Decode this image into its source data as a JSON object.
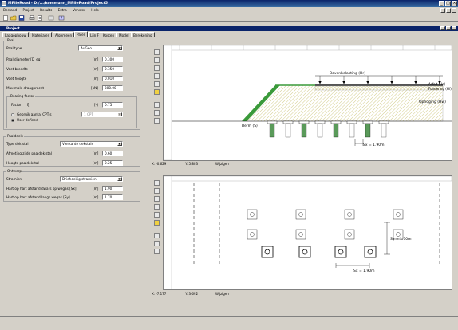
{
  "app": {
    "title": "MPileRoad - D:/.../kommunn_MPileRoad/Project5",
    "window_controls": [
      "minimize-icon",
      "maximize-icon",
      "close-icon"
    ]
  },
  "menu": [
    "Bestand",
    "Project",
    "Results",
    "Extra",
    "Venster",
    "Help"
  ],
  "toolbar_icons": [
    "new-icon",
    "open-icon",
    "save-icon",
    "print-icon",
    "preview-icon",
    "export-icon",
    "calculate-icon",
    "help-icon"
  ],
  "subwindow": {
    "title": "Project"
  },
  "tabs": [
    {
      "label": "Laagopbouw"
    },
    {
      "label": "Materialen"
    },
    {
      "label": "Algemeen"
    },
    {
      "label": "Palen"
    },
    {
      "label": "Lijn F"
    },
    {
      "label": "Kosten"
    },
    {
      "label": "Model"
    },
    {
      "label": "Berekening"
    }
  ],
  "active_tab": "Palen",
  "paal": {
    "group": "Paal",
    "paal_type_label": "Paal type",
    "paal_type_value": "AuGeo",
    "rows": [
      {
        "label": "Paal diameter [D_eq]",
        "unit": "[m]",
        "value": "0.300"
      },
      {
        "label": "Voet breedte",
        "unit": "[m]",
        "value": "0.350"
      },
      {
        "label": "Voet hoogte",
        "unit": "[m]",
        "value": "0.010"
      },
      {
        "label": "Maximale draagkracht",
        "unit": "[kN]",
        "value": "300.00"
      }
    ]
  },
  "bearing": {
    "group": "Bearing factor",
    "factor_label": "Factor",
    "factor_symbol": "ξ",
    "factor_unit": "[-]",
    "factor_value": "0.75",
    "radio1": "Gebruik aantal CPT's",
    "radio2": "User defined",
    "cpt_select": "1 CPT"
  },
  "paaldeel": {
    "group": "Paaldeels",
    "type_label": "Type dek.stal",
    "type_value": "Vierkante dekstals",
    "afmeting_label": "Afmeting zijde paaldek.stal",
    "afmeting_unit": "[m]",
    "afmeting_value": "0.60",
    "hoogte_label": "Hoogte paaldekstal",
    "hoogte_unit": "[m]",
    "hoogte_value": "0.25"
  },
  "ontwerp": {
    "group": "Ontwerp",
    "stramien_label": "Stramien",
    "stramien_value": "Driehoekig stramien",
    "rows": [
      {
        "label": "Hart op hart afstand dwars op wegas [Sx]",
        "unit": "[m]",
        "value": "1.90"
      },
      {
        "label": "Hart op hart afstand langs wegas [Sy]",
        "unit": "[m]",
        "value": "1.70"
      }
    ]
  },
  "top_view": {
    "labels": {
      "verkeer": "Bovenbelasting (Hr)",
      "asfalt": "Asfalt (Ha)",
      "fundering": "Fundering (Hf)",
      "ophoging": "Ophoging (Hw)",
      "berm": "Berm (S)",
      "sx": "Sx = 1.90m"
    },
    "status": {
      "x": "X: -0.629",
      "y": "Y: 5.803",
      "mode": "Wijzigen"
    }
  },
  "bottom_view": {
    "labels": {
      "sy": "Sy = 1.70m",
      "sx": "Sx = 1.90m"
    },
    "status": {
      "x": "X: -7.177",
      "y": "Y: 3.692",
      "mode": "Wijzigen"
    }
  },
  "colors": {
    "titlebar": "#0a246a",
    "face": "#d4d0c8",
    "embankment_green": "#3a9a3a",
    "hatch": "#c8c070",
    "pile_green": "#5a9a5a"
  }
}
